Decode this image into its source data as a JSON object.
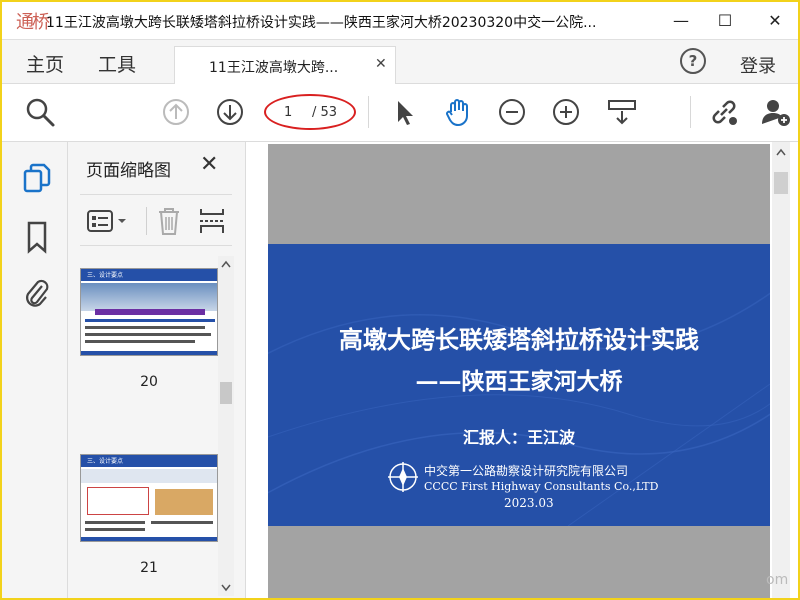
{
  "window": {
    "title": "11王江波高墩大跨长联矮塔斜拉桥设计实践——陕西王家河大桥20230320中交一公院...",
    "logo_text": "通桥",
    "min_symbol": "—",
    "max_symbol": "☐",
    "close_symbol": "✕"
  },
  "menu": {
    "home": "主页",
    "tools": "工具",
    "help": "?",
    "login": "登录"
  },
  "tab": {
    "label": "11王江波高墩大跨...",
    "close": "✕"
  },
  "toolbar": {
    "page_current": "1",
    "page_total": "/ 53"
  },
  "thumbnail_panel": {
    "title": "页面缩略图",
    "close": "✕",
    "pages": [
      {
        "number": "20",
        "heading": "三、设计要点"
      },
      {
        "number": "21",
        "heading": "三、设计要点"
      }
    ]
  },
  "slide": {
    "title": "高墩大跨长联矮塔斜拉桥设计实践",
    "subtitle": "——陕西王家河大桥",
    "reporter": "汇报人：王江波",
    "org_cn": "中交第一公路勘察设计研究院有限公司",
    "org_en": "CCCC First Highway Consultants Co.,LTD",
    "date": "2023.03"
  },
  "watermark": "om",
  "colors": {
    "slide_bg": "#2550a8",
    "highlight_ellipse": "#d92020",
    "accent_blue": "#1a73c9",
    "frame_border": "#f2d21b"
  }
}
